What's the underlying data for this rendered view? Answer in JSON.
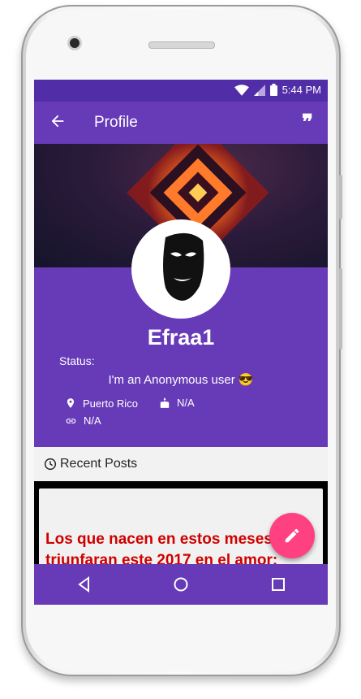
{
  "statusbar": {
    "time": "5:44 PM"
  },
  "appbar": {
    "title": "Profile",
    "quote_glyph": "❞"
  },
  "profile": {
    "username": "Efraa1",
    "status_label": "Status:",
    "status_text": "I'm an Anonymous user 😎",
    "location": "Puerto Rico",
    "birthday": "N/A",
    "link": "N/A"
  },
  "recent": {
    "label": "Recent Posts"
  },
  "post": {
    "line1": "Los que nacen en estos meses",
    "line2": "triunfaran este 2017 en el amor:"
  },
  "colors": {
    "primary": "#673ab7",
    "primary_dark": "#512da8",
    "accent": "#ff4081",
    "post_text": "#d00000"
  },
  "icons": [
    "wifi-icon",
    "signal-icon",
    "battery-icon",
    "back-arrow-icon",
    "quote-icon",
    "location-icon",
    "cake-icon",
    "link-icon",
    "clock-icon",
    "edit-icon",
    "nav-back-icon",
    "nav-home-icon",
    "nav-recents-icon"
  ]
}
